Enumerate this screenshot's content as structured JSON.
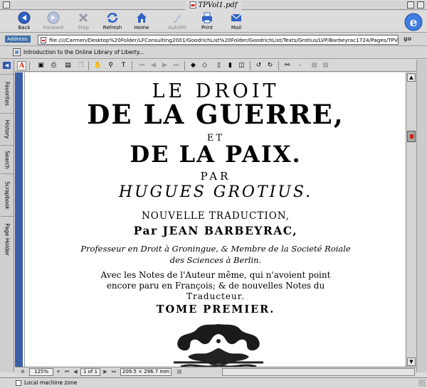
{
  "window": {
    "title": "TPVol1.pdf"
  },
  "toolbar": {
    "buttons": [
      {
        "label": "Back",
        "enabled": true
      },
      {
        "label": "Forward",
        "enabled": false
      },
      {
        "label": "Stop",
        "enabled": false
      },
      {
        "label": "Refresh",
        "enabled": true
      },
      {
        "label": "Home",
        "enabled": true
      },
      {
        "label": "AutoFill",
        "enabled": false
      },
      {
        "label": "Print",
        "enabled": true
      },
      {
        "label": "Mail",
        "enabled": true
      }
    ]
  },
  "address": {
    "label": "Address:",
    "value": "file:////Carmen/Desktop%20Folder/LFConsulting2001/GoodrichList%20Folder/GoodrichList/Texts/Grotius/LVP/Barbeyrac1724/Pages/TPVol",
    "go_label": "go"
  },
  "favorites_bar": {
    "items": [
      {
        "label": "Introduction to the Online Library of Liberty..."
      }
    ]
  },
  "explorer_tabs": [
    "Favorites",
    "History",
    "Search",
    "Scrapbook",
    "Page Holder"
  ],
  "document": {
    "lines": [
      "LE DROIT",
      "DE LA GUERRE,",
      "ET",
      "DE LA PAIX.",
      "PAR",
      "HUGUES GROTIUS.",
      "NOUVELLE TRADUCTION,",
      "Par JEAN BARBEYRAC,",
      "Professeur en Droit à Groningue, & Membre de la Societé Roiale",
      "des Sciences à Berlin.",
      "Avec les Notes de l'Auteur même, qui n'avoient point",
      "encore paru en François; & de nouvelles Notes du",
      "Traducteur.",
      "TOME PREMIER."
    ]
  },
  "pdf_status": {
    "zoom": "125%",
    "page": "1 of 1",
    "page_size": "209.5 × 296.7 mm"
  },
  "status_bar": {
    "text": "Local machine zone"
  },
  "colors": {
    "accent": "#3a5fa8",
    "pdf_red": "#d31"
  }
}
